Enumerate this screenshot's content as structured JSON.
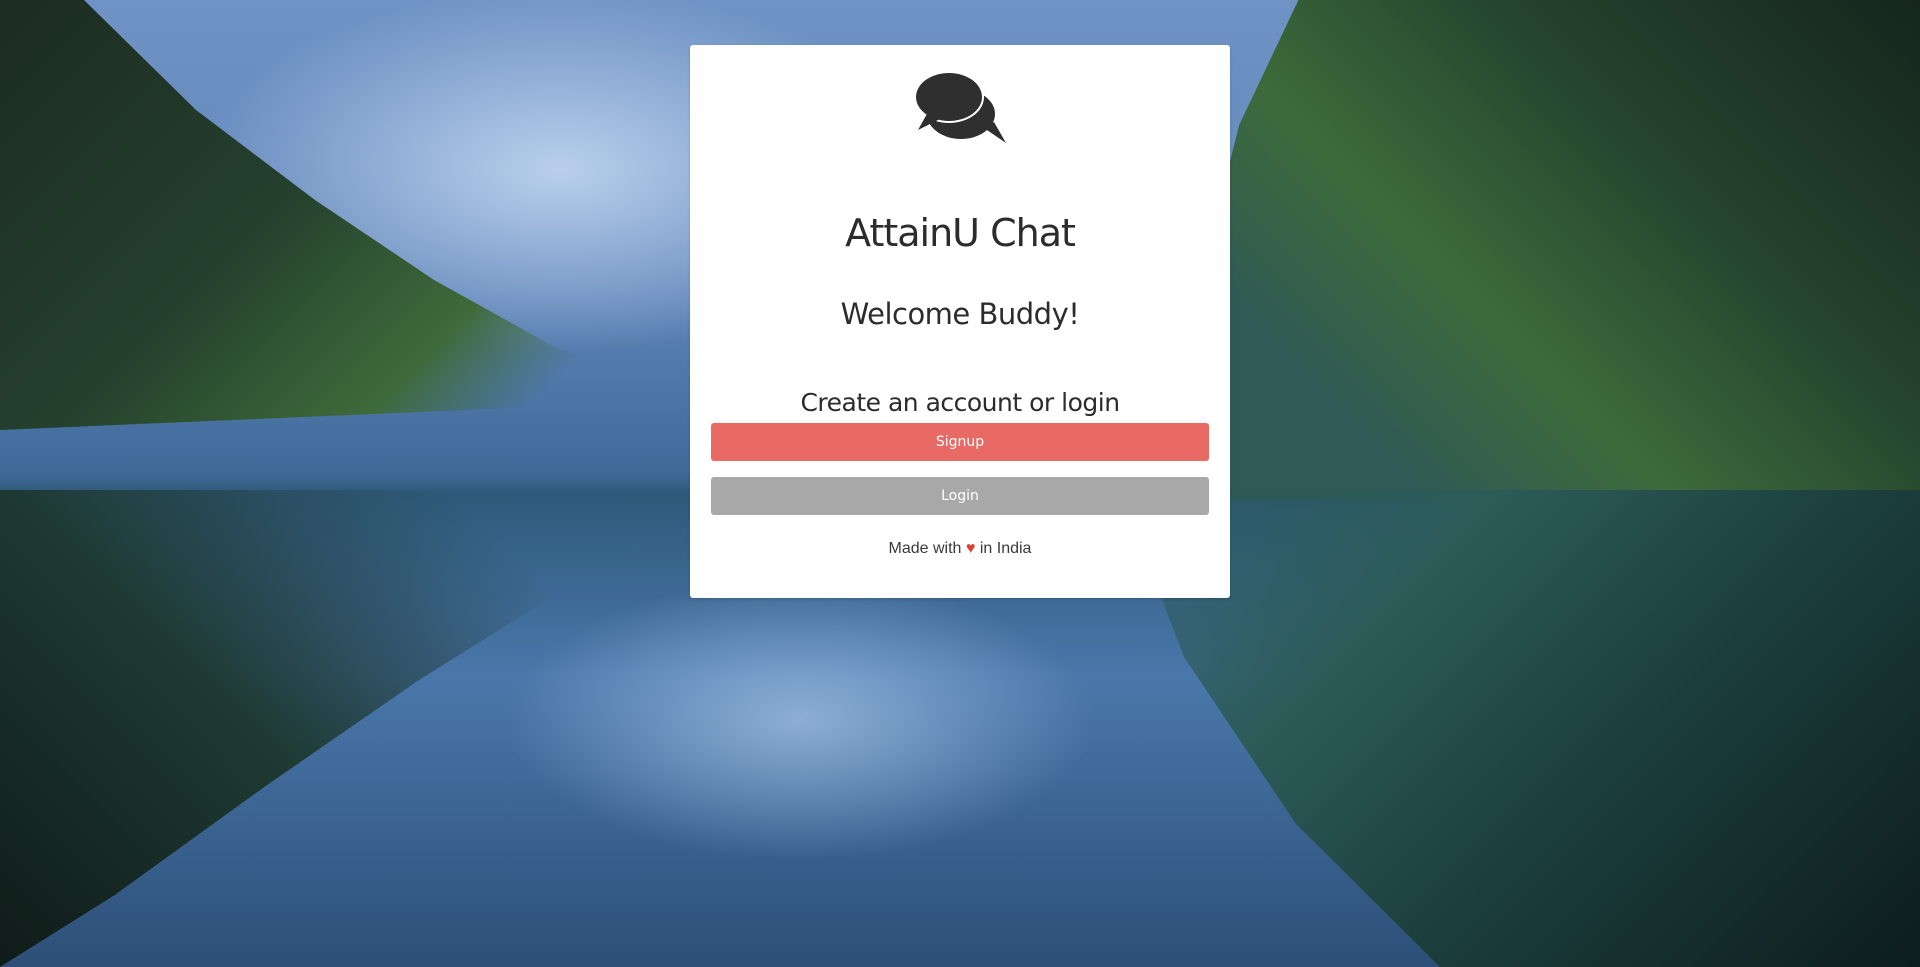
{
  "app": {
    "title": "AttainU Chat",
    "icon": "chat-bubbles-icon"
  },
  "welcome": {
    "heading": "Welcome Buddy!",
    "subheading": "Create an account or login"
  },
  "actions": {
    "signup_label": "Signup",
    "login_label": "Login"
  },
  "footer": {
    "prefix": "Made with",
    "heart": "♥",
    "suffix": "in India"
  },
  "colors": {
    "signup": "#e96a65",
    "login": "#a8a8a8",
    "heart": "#e43d30",
    "text": "#2c2c2c"
  }
}
